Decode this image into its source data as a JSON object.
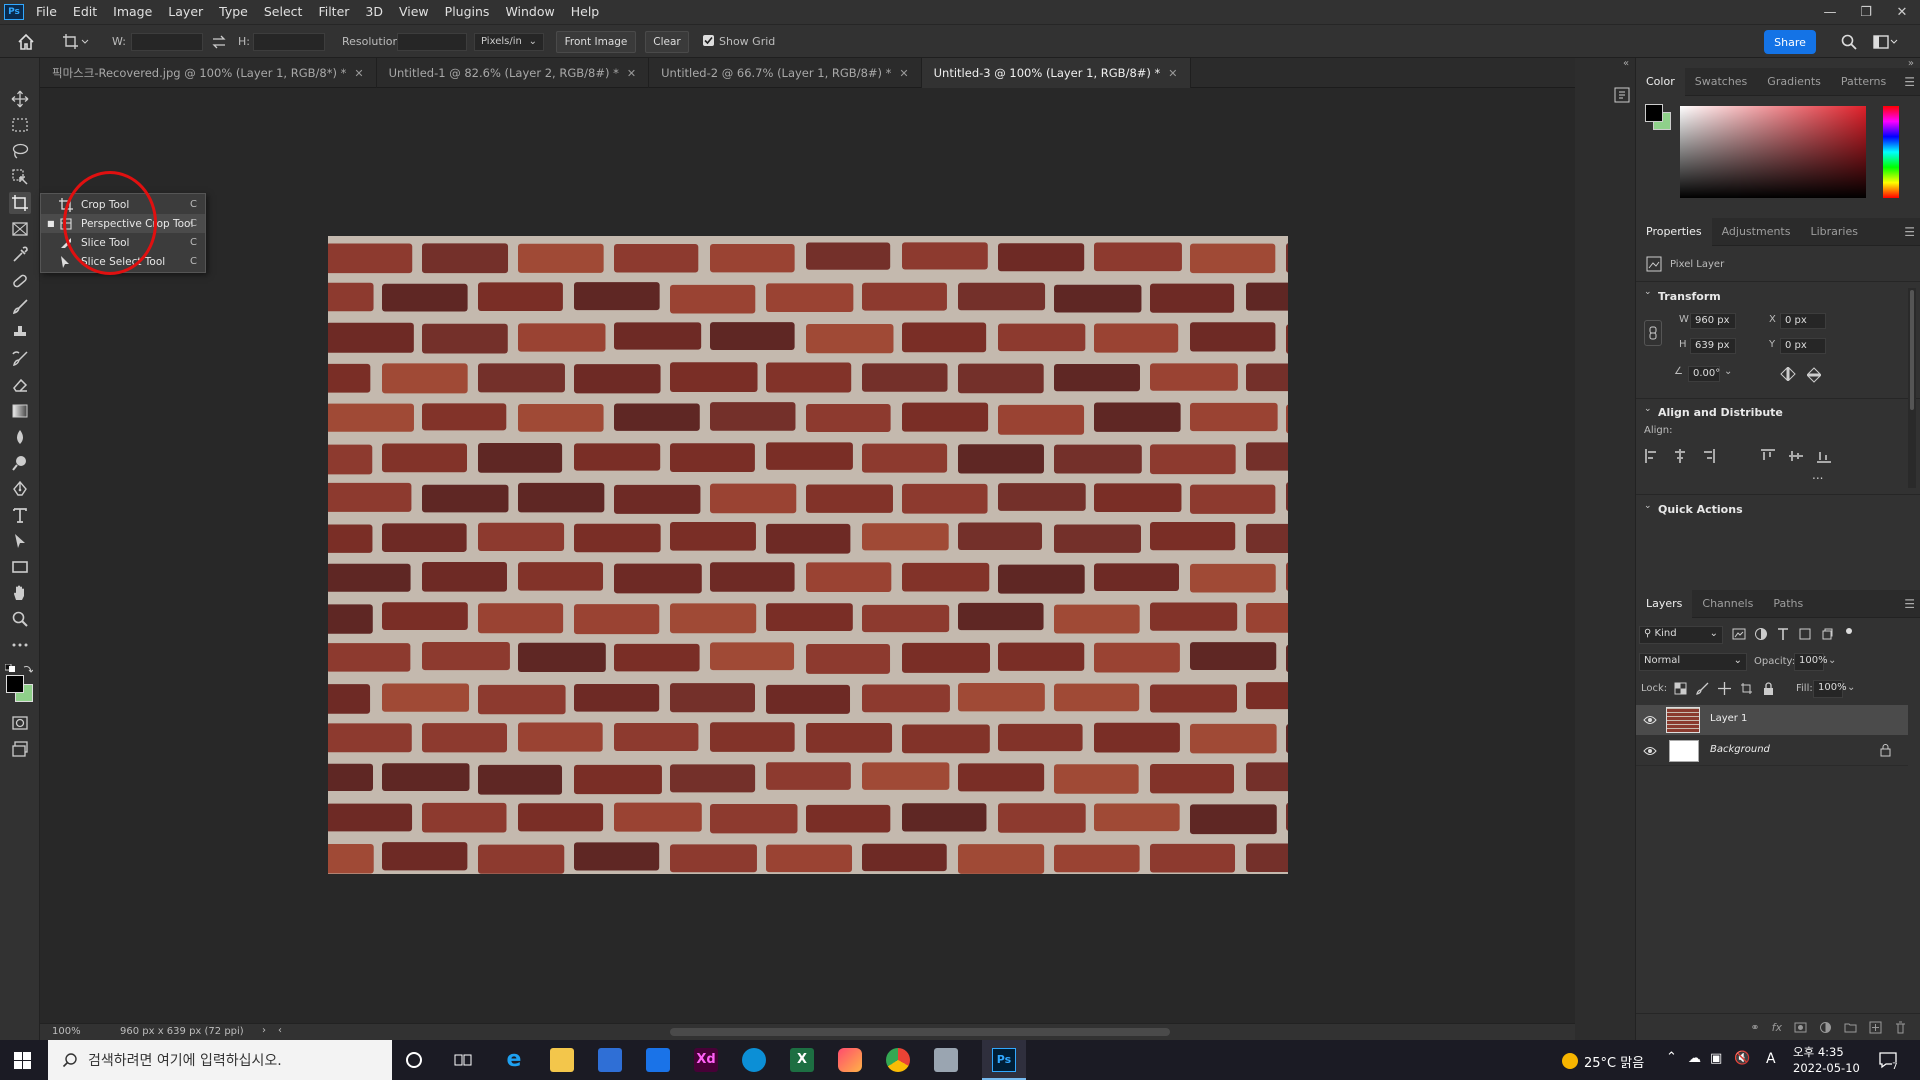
{
  "menubar": {
    "logo": "Ps",
    "items": [
      "File",
      "Edit",
      "Image",
      "Layer",
      "Type",
      "Select",
      "Filter",
      "3D",
      "View",
      "Plugins",
      "Window",
      "Help"
    ]
  },
  "options": {
    "w_label": "W:",
    "h_label": "H:",
    "resolution_label": "Resolution:",
    "units": "Pixels/in",
    "front_image": "Front Image",
    "clear": "Clear",
    "show_grid": "Show Grid",
    "share": "Share"
  },
  "tabs": [
    {
      "label": "픽마스크-Recovered.jpg @ 100% (Layer 1, RGB/8*) *"
    },
    {
      "label": "Untitled-1 @ 82.6% (Layer 2, RGB/8#) *"
    },
    {
      "label": "Untitled-2 @ 66.7% (Layer 1, RGB/8#) *"
    },
    {
      "label": "Untitled-3 @ 100% (Layer 1, RGB/8#) *"
    }
  ],
  "flyout": [
    {
      "label": "Crop Tool",
      "key": "C"
    },
    {
      "label": "Perspective Crop Tool",
      "key": "C"
    },
    {
      "label": "Slice Tool",
      "key": "C"
    },
    {
      "label": "Slice Select Tool",
      "key": "C"
    }
  ],
  "status": {
    "zoom": "100%",
    "doc_info": "960 px x 639 px (72 ppi)"
  },
  "color_panel": {
    "tabs": [
      "Color",
      "Swatches",
      "Gradients",
      "Patterns"
    ],
    "fg": "#000000",
    "bg": "#8fd08a"
  },
  "properties": {
    "tabs": [
      "Properties",
      "Adjustments",
      "Libraries"
    ],
    "kind": "Pixel Layer",
    "transform_title": "Transform",
    "w_label": "W",
    "w": "960 px",
    "h_label": "H",
    "h": "639 px",
    "x_label": "X",
    "x": "0 px",
    "y_label": "Y",
    "y": "0 px",
    "angle": "0.00°",
    "align_title": "Align and Distribute",
    "align_label": "Align:",
    "more": "...",
    "quick_title": "Quick Actions"
  },
  "layers_panel": {
    "tabs": [
      "Layers",
      "Channels",
      "Paths"
    ],
    "kind": "Kind",
    "blend": "Normal",
    "opacity_label": "Opacity:",
    "opacity": "100%",
    "lock_label": "Lock:",
    "fill_label": "Fill:",
    "fill": "100%",
    "layers": [
      {
        "name": "Layer 1"
      },
      {
        "name": "Background"
      }
    ]
  },
  "taskbar": {
    "search_placeholder": "검색하려면 여기에 입력하십시오.",
    "weather": "25°C 맑음",
    "ime": "A",
    "time": "오후 4:35",
    "date": "2022-05-10",
    "notif": "7"
  }
}
